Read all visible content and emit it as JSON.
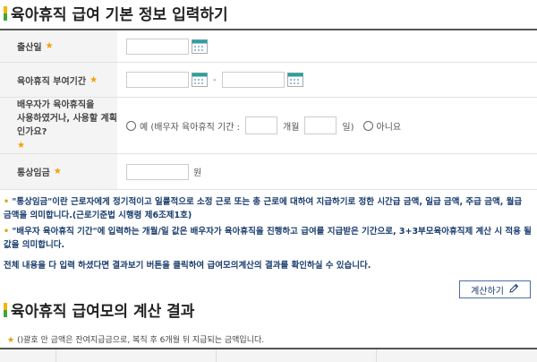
{
  "section1": {
    "title": "육아휴직 급여 기본 정보 입력하기"
  },
  "form": {
    "birth": {
      "label": "출산일",
      "required": "★"
    },
    "period": {
      "label": "육아휴직 부여기간",
      "required": "★",
      "separator": "-"
    },
    "spouse": {
      "label_line1": "배우자가 육아휴직을",
      "label_line2": "사용하였거나, 사용할 계획인가요?",
      "required": "★",
      "yes_label": "예 (배우자 육아휴직 기간 :",
      "months_unit": "개월",
      "days_unit": "일)",
      "no_label": "아니요"
    },
    "wage": {
      "label": "통상임금",
      "required": "★",
      "unit": "원"
    }
  },
  "notes": {
    "note1": "\"통상임금\"이란 근로자에게 정기적이고 일률적으로 소정 근로 또는 총 근로에 대하여 지급하기로 정한 시간급 금액, 일급 금액, 주급 금액, 월급 금액을 의미합니다.(근로기준법 시행령 제6조제1호)",
    "note2": "\"배우자 육아휴직 기간\"에 입력하는 개월/일 값은 배우자가 육아휴직을 진행하고 급여를 지급받은 기간으로, 3+3부모육아휴직제 계산 시 적용 될 값을 의미합니다.",
    "note3": "전체 내용을 다 입력 하셨다면 결과보기 버튼을 클릭하여 급여모의계산의 결과를 확인하실 수 있습니다."
  },
  "buttons": {
    "calc_label": "계산하기"
  },
  "section2": {
    "title": "육아휴직 급여모의 계산 결과",
    "hint": "()괄호 안 금액은 잔여지급금으로, 복직 후 6개월 뒤 지급되는 금액입니다."
  },
  "colors": {
    "accent_yellow": "#f5b400",
    "accent_green": "#3aaa35",
    "navy": "#1a3d6e",
    "calendar_teal": "#2f9e9e"
  },
  "icons": {
    "calendar": "calendar-icon",
    "pencil": "pencil-icon"
  }
}
